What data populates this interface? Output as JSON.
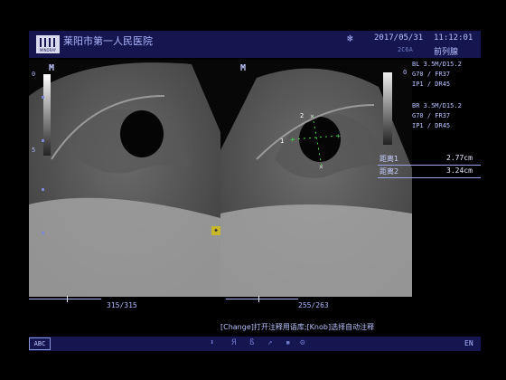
{
  "header": {
    "logo_text": "MINDRAY",
    "hospital": "莱阳市第一人民医院",
    "freeze_icon": "snowflake-icon",
    "date": "2017/05/31",
    "time": "11:12:01",
    "probe": "2C6A",
    "preset": "前列腺"
  },
  "left_image": {
    "marker": "M",
    "depth_top": "0",
    "depth_mid": "5"
  },
  "right_image": {
    "marker": "M",
    "caliper_1": "1",
    "caliper_2": "2",
    "depth_top": "0"
  },
  "params_1": [
    "BL 3.5M/D15.2",
    "G70 / FR37",
    "IP1 / DR45"
  ],
  "params_2": [
    "BR 3.5M/D15.2",
    "G70 / FR37",
    "IP1 / DR45"
  ],
  "measurements": [
    {
      "label": "距离1",
      "value": "2.77cm"
    },
    {
      "label": "距离2",
      "value": "3.24cm"
    }
  ],
  "cine": {
    "left": "315/315",
    "right": "255/263"
  },
  "hint": "[Change]打开注释用语库;[Knob]选择自动注释",
  "footer": {
    "abc": "ABC",
    "lang": "EN",
    "icons": [
      "cursor-icon",
      "font-r-icon",
      "font-b-icon",
      "arrow-icon",
      "body-mark-icon",
      "settings-icon"
    ]
  },
  "colors": {
    "bar": "#15154f",
    "text": "#b8c2ff",
    "caliper": "#4cd24c"
  }
}
